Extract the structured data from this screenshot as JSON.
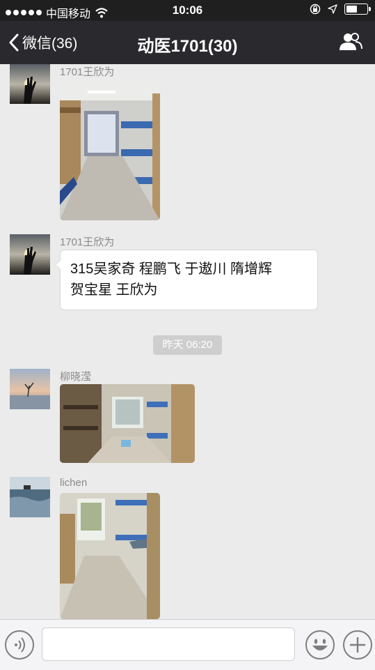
{
  "status_bar": {
    "carrier": "中国移动",
    "time": "10:06",
    "battery_level": 0.55
  },
  "nav": {
    "back_label": "微信(36)",
    "title": "动医1701(30)"
  },
  "messages": [
    {
      "sender": "1701王欣为",
      "type": "image"
    },
    {
      "sender": "1701王欣为",
      "type": "text",
      "text_line1": "315吴家奇 程鹏飞 于遨川 隋增辉",
      "text_line2": "贺宝星  王欣为"
    },
    {
      "type": "timestamp",
      "text": "昨天 06:20"
    },
    {
      "sender": "柳晓滢",
      "type": "image"
    },
    {
      "sender": "lichen",
      "type": "image"
    }
  ],
  "input_bar": {
    "voice": "voice-icon",
    "emoji": "emoji-icon",
    "plus": "plus-icon"
  }
}
